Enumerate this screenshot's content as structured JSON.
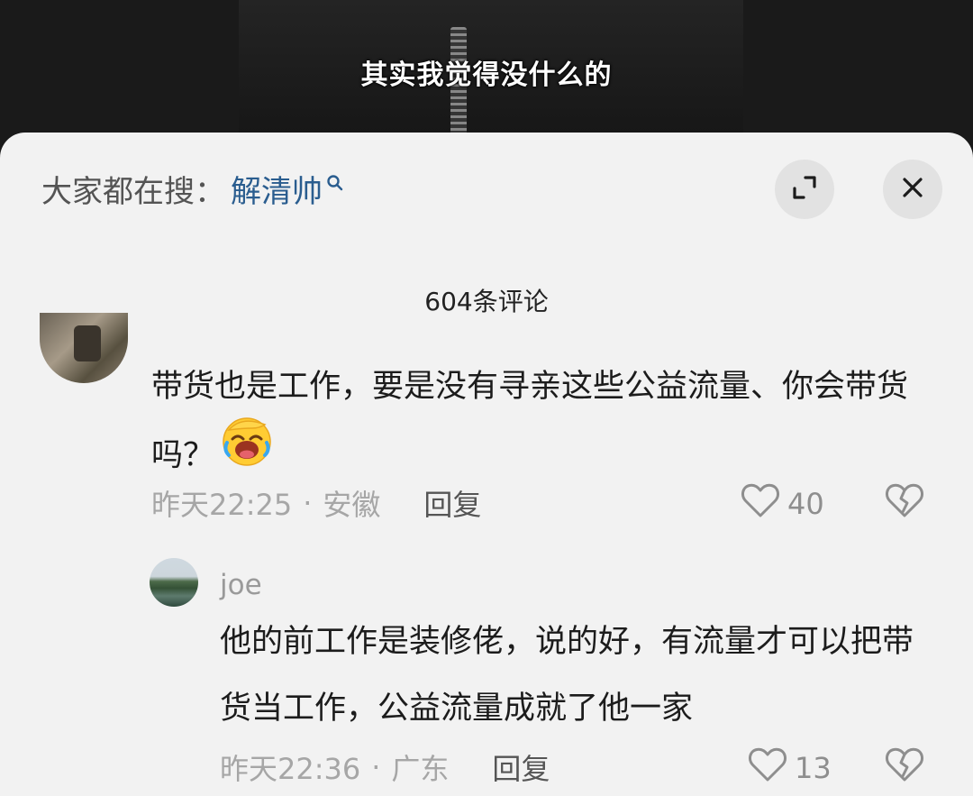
{
  "video": {
    "subtitle": "其实我觉得没什么的"
  },
  "sheet": {
    "search_prefix": "大家都在搜：",
    "search_term": "解清帅",
    "comment_count": "604条评论",
    "icons": {
      "search": "search-icon",
      "expand": "expand-icon",
      "close": "close-icon"
    }
  },
  "comments": [
    {
      "text": "带货也是工作，要是没有寻亲这些公益流量、你会带货吗？",
      "emoji": "facepalm-laughing-emoji",
      "time": "昨天22:25",
      "location": "安徽",
      "reply_label": "回复",
      "likes": "40",
      "replies": [
        {
          "username": "joe",
          "text": "他的前工作是装修佬，说的好，有流量才可以把带货当工作，公益流量成就了他一家",
          "time": "昨天22:36",
          "location": "广东",
          "reply_label": "回复",
          "likes": "13"
        }
      ]
    }
  ],
  "colors": {
    "sheet_bg": "#f2f2f2",
    "link_blue": "#2a5d8f",
    "meta_gray": "#a6a6a6"
  }
}
